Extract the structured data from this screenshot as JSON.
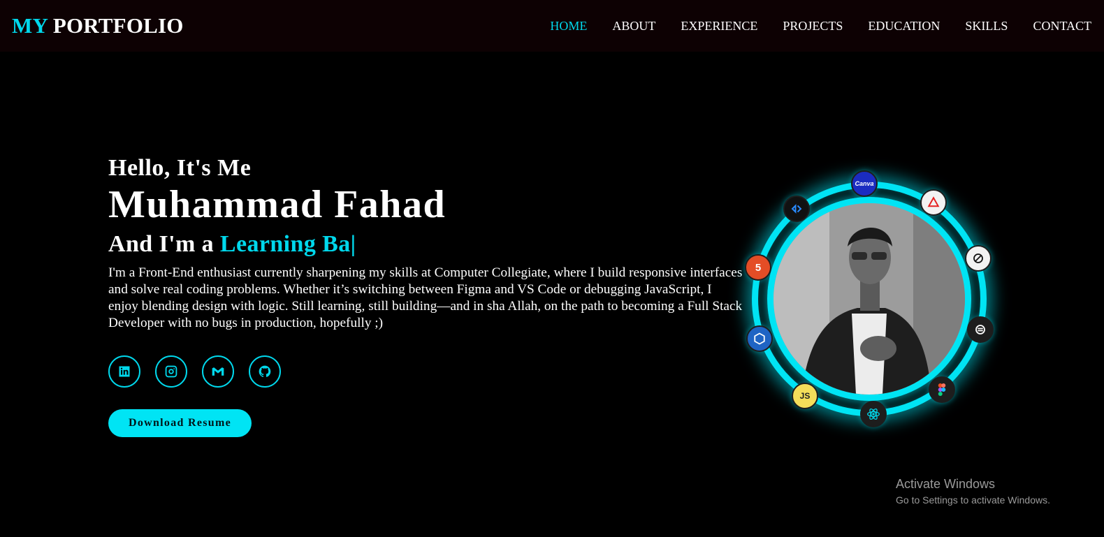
{
  "header": {
    "logo_accent": "MY",
    "logo_rest": "PORTFOLIO",
    "nav": [
      {
        "label": "HOME",
        "active": true
      },
      {
        "label": "ABOUT",
        "active": false
      },
      {
        "label": "EXPERIENCE",
        "active": false
      },
      {
        "label": "PROJECTS",
        "active": false
      },
      {
        "label": "EDUCATION",
        "active": false
      },
      {
        "label": "SKILLS",
        "active": false
      },
      {
        "label": "CONTACT",
        "active": false
      }
    ]
  },
  "hero": {
    "greeting": "Hello, It's Me",
    "name": "Muhammad Fahad",
    "role_prefix": "And I'm a",
    "role_typed": "Learning Ba|",
    "bio": "I'm a Front-End enthusiast currently sharpening my skills at Computer Collegiate, where I build responsive interfaces and solve real coding problems. Whether it’s switching between Figma and VS Code or debugging JavaScript, I enjoy blending design with logic. Still learning, still building—and in sha Allah, on the path to becoming a Full Stack Developer with no bugs in production, hopefully ;)",
    "socials": [
      {
        "icon": "linkedin-icon"
      },
      {
        "icon": "instagram-icon"
      },
      {
        "icon": "gmail-icon"
      },
      {
        "icon": "github-icon"
      }
    ],
    "resume_label": "Download Resume"
  },
  "orbit": {
    "chips": [
      {
        "icon": "canva-icon",
        "text": "Canva"
      },
      {
        "icon": "dev-tool-icon",
        "text": ""
      },
      {
        "icon": "vercel-icon",
        "text": ""
      },
      {
        "icon": "html5-icon",
        "text": "5"
      },
      {
        "icon": "openai-icon",
        "text": ""
      },
      {
        "icon": "nodejs-icon",
        "text": ""
      },
      {
        "icon": "javascript-icon",
        "text": "JS"
      },
      {
        "icon": "react-icon",
        "text": ""
      },
      {
        "icon": "figma-icon",
        "text": ""
      },
      {
        "icon": "lucide-icon",
        "text": ""
      }
    ]
  },
  "watermark": {
    "line1": "Activate Windows",
    "line2": "Go to Settings to activate Windows."
  },
  "colors": {
    "accent": "#00d8ec",
    "background": "#000000",
    "navbar": "#0d0103"
  }
}
